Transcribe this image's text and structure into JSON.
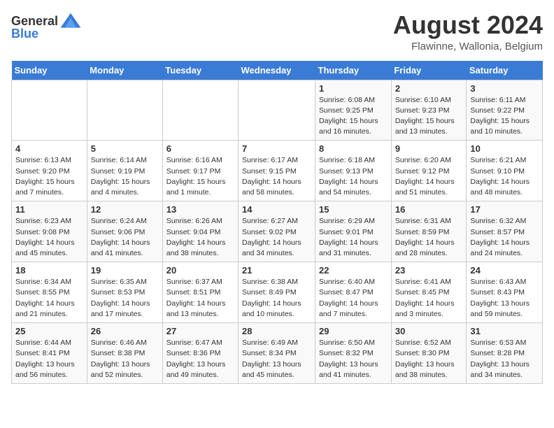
{
  "header": {
    "logo_general": "General",
    "logo_blue": "Blue",
    "month_year": "August 2024",
    "location": "Flawinne, Wallonia, Belgium"
  },
  "weekdays": [
    "Sunday",
    "Monday",
    "Tuesday",
    "Wednesday",
    "Thursday",
    "Friday",
    "Saturday"
  ],
  "weeks": [
    [
      {
        "day": "",
        "info": ""
      },
      {
        "day": "",
        "info": ""
      },
      {
        "day": "",
        "info": ""
      },
      {
        "day": "",
        "info": ""
      },
      {
        "day": "1",
        "info": "Sunrise: 6:08 AM\nSunset: 9:25 PM\nDaylight: 15 hours\nand 16 minutes."
      },
      {
        "day": "2",
        "info": "Sunrise: 6:10 AM\nSunset: 9:23 PM\nDaylight: 15 hours\nand 13 minutes."
      },
      {
        "day": "3",
        "info": "Sunrise: 6:11 AM\nSunset: 9:22 PM\nDaylight: 15 hours\nand 10 minutes."
      }
    ],
    [
      {
        "day": "4",
        "info": "Sunrise: 6:13 AM\nSunset: 9:20 PM\nDaylight: 15 hours\nand 7 minutes."
      },
      {
        "day": "5",
        "info": "Sunrise: 6:14 AM\nSunset: 9:19 PM\nDaylight: 15 hours\nand 4 minutes."
      },
      {
        "day": "6",
        "info": "Sunrise: 6:16 AM\nSunset: 9:17 PM\nDaylight: 15 hours\nand 1 minute."
      },
      {
        "day": "7",
        "info": "Sunrise: 6:17 AM\nSunset: 9:15 PM\nDaylight: 14 hours\nand 58 minutes."
      },
      {
        "day": "8",
        "info": "Sunrise: 6:18 AM\nSunset: 9:13 PM\nDaylight: 14 hours\nand 54 minutes."
      },
      {
        "day": "9",
        "info": "Sunrise: 6:20 AM\nSunset: 9:12 PM\nDaylight: 14 hours\nand 51 minutes."
      },
      {
        "day": "10",
        "info": "Sunrise: 6:21 AM\nSunset: 9:10 PM\nDaylight: 14 hours\nand 48 minutes."
      }
    ],
    [
      {
        "day": "11",
        "info": "Sunrise: 6:23 AM\nSunset: 9:08 PM\nDaylight: 14 hours\nand 45 minutes."
      },
      {
        "day": "12",
        "info": "Sunrise: 6:24 AM\nSunset: 9:06 PM\nDaylight: 14 hours\nand 41 minutes."
      },
      {
        "day": "13",
        "info": "Sunrise: 6:26 AM\nSunset: 9:04 PM\nDaylight: 14 hours\nand 38 minutes."
      },
      {
        "day": "14",
        "info": "Sunrise: 6:27 AM\nSunset: 9:02 PM\nDaylight: 14 hours\nand 34 minutes."
      },
      {
        "day": "15",
        "info": "Sunrise: 6:29 AM\nSunset: 9:01 PM\nDaylight: 14 hours\nand 31 minutes."
      },
      {
        "day": "16",
        "info": "Sunrise: 6:31 AM\nSunset: 8:59 PM\nDaylight: 14 hours\nand 28 minutes."
      },
      {
        "day": "17",
        "info": "Sunrise: 6:32 AM\nSunset: 8:57 PM\nDaylight: 14 hours\nand 24 minutes."
      }
    ],
    [
      {
        "day": "18",
        "info": "Sunrise: 6:34 AM\nSunset: 8:55 PM\nDaylight: 14 hours\nand 21 minutes."
      },
      {
        "day": "19",
        "info": "Sunrise: 6:35 AM\nSunset: 8:53 PM\nDaylight: 14 hours\nand 17 minutes."
      },
      {
        "day": "20",
        "info": "Sunrise: 6:37 AM\nSunset: 8:51 PM\nDaylight: 14 hours\nand 13 minutes."
      },
      {
        "day": "21",
        "info": "Sunrise: 6:38 AM\nSunset: 8:49 PM\nDaylight: 14 hours\nand 10 minutes."
      },
      {
        "day": "22",
        "info": "Sunrise: 6:40 AM\nSunset: 8:47 PM\nDaylight: 14 hours\nand 7 minutes."
      },
      {
        "day": "23",
        "info": "Sunrise: 6:41 AM\nSunset: 8:45 PM\nDaylight: 14 hours\nand 3 minutes."
      },
      {
        "day": "24",
        "info": "Sunrise: 6:43 AM\nSunset: 8:43 PM\nDaylight: 13 hours\nand 59 minutes."
      }
    ],
    [
      {
        "day": "25",
        "info": "Sunrise: 6:44 AM\nSunset: 8:41 PM\nDaylight: 13 hours\nand 56 minutes."
      },
      {
        "day": "26",
        "info": "Sunrise: 6:46 AM\nSunset: 8:38 PM\nDaylight: 13 hours\nand 52 minutes."
      },
      {
        "day": "27",
        "info": "Sunrise: 6:47 AM\nSunset: 8:36 PM\nDaylight: 13 hours\nand 49 minutes."
      },
      {
        "day": "28",
        "info": "Sunrise: 6:49 AM\nSunset: 8:34 PM\nDaylight: 13 hours\nand 45 minutes."
      },
      {
        "day": "29",
        "info": "Sunrise: 6:50 AM\nSunset: 8:32 PM\nDaylight: 13 hours\nand 41 minutes."
      },
      {
        "day": "30",
        "info": "Sunrise: 6:52 AM\nSunset: 8:30 PM\nDaylight: 13 hours\nand 38 minutes."
      },
      {
        "day": "31",
        "info": "Sunrise: 6:53 AM\nSunset: 8:28 PM\nDaylight: 13 hours\nand 34 minutes."
      }
    ]
  ]
}
